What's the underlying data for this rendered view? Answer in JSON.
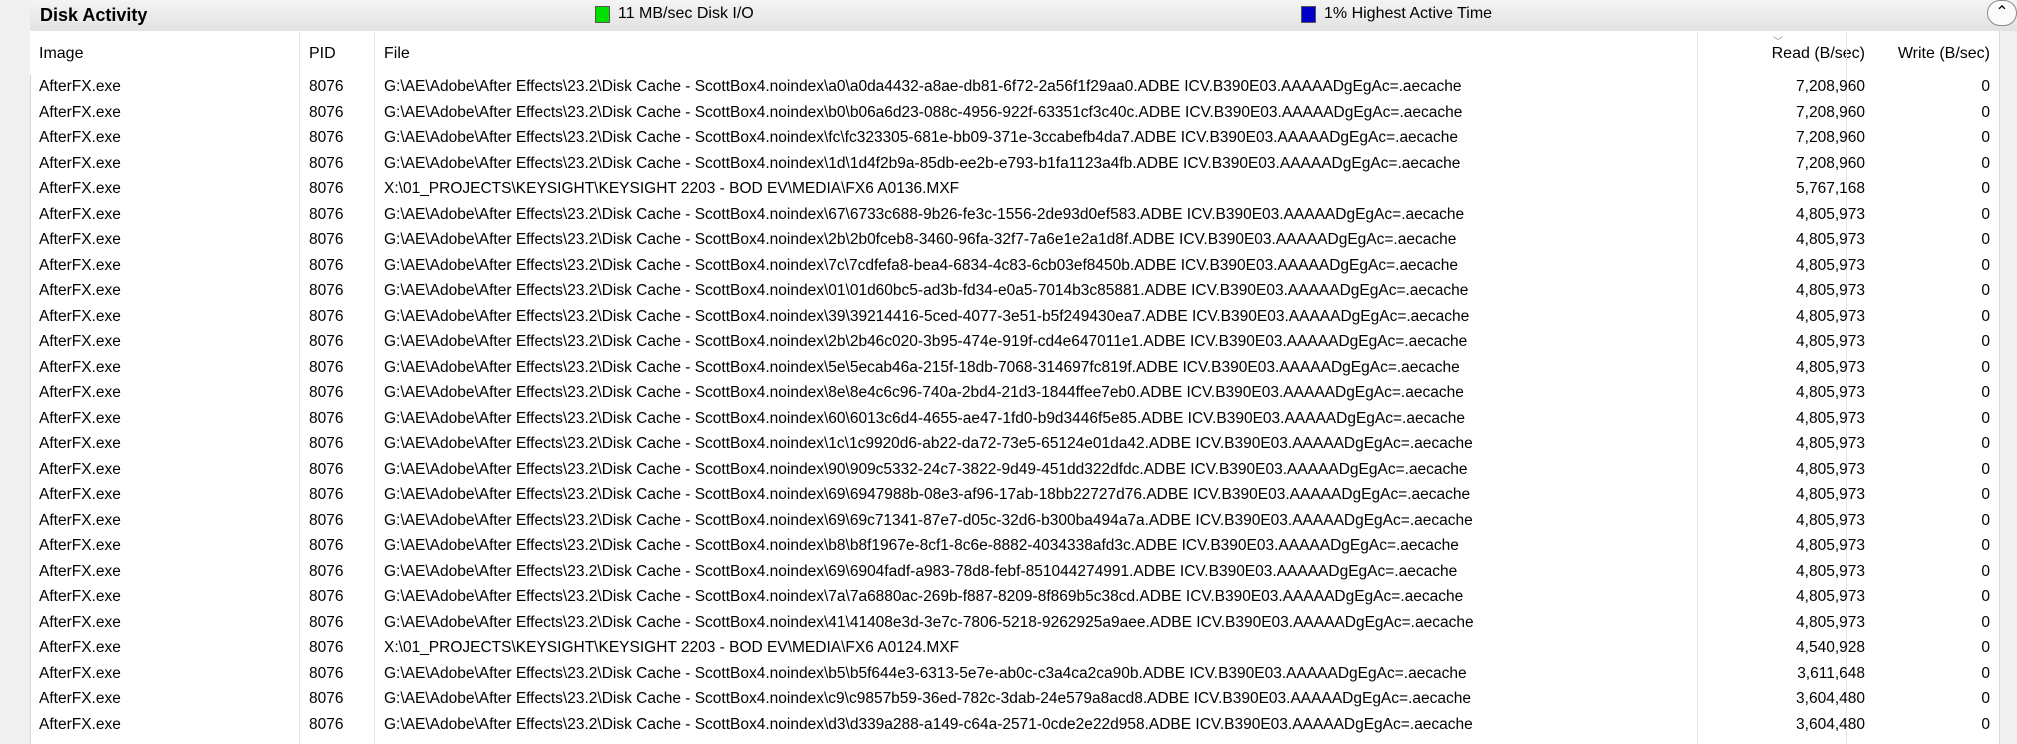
{
  "header": {
    "title": "Disk Activity",
    "io_legend": "11 MB/sec Disk I/O",
    "io_color": "#00e000",
    "active_legend": "1% Highest Active Time",
    "active_color": "#0000c8",
    "collapse_glyph": "⌃"
  },
  "columns": {
    "image": "Image",
    "pid": "PID",
    "file": "File",
    "read": "Read (B/sec)",
    "write": "Write (B/sec)"
  },
  "rows": [
    {
      "image": "AfterFX.exe",
      "pid": "8076",
      "file": "G:\\AE\\Adobe\\After Effects\\23.2\\Disk Cache - ScottBox4.noindex\\a0\\a0da4432-a8ae-db81-6f72-2a56f1f29aa0.ADBE ICV.B390E03.AAAAADgEgAc=.aecache",
      "read": "7,208,960",
      "write": "0"
    },
    {
      "image": "AfterFX.exe",
      "pid": "8076",
      "file": "G:\\AE\\Adobe\\After Effects\\23.2\\Disk Cache - ScottBox4.noindex\\b0\\b06a6d23-088c-4956-922f-63351cf3c40c.ADBE ICV.B390E03.AAAAADgEgAc=.aecache",
      "read": "7,208,960",
      "write": "0"
    },
    {
      "image": "AfterFX.exe",
      "pid": "8076",
      "file": "G:\\AE\\Adobe\\After Effects\\23.2\\Disk Cache - ScottBox4.noindex\\fc\\fc323305-681e-bb09-371e-3ccabefb4da7.ADBE ICV.B390E03.AAAAADgEgAc=.aecache",
      "read": "7,208,960",
      "write": "0"
    },
    {
      "image": "AfterFX.exe",
      "pid": "8076",
      "file": "G:\\AE\\Adobe\\After Effects\\23.2\\Disk Cache - ScottBox4.noindex\\1d\\1d4f2b9a-85db-ee2b-e793-b1fa1123a4fb.ADBE ICV.B390E03.AAAAADgEgAc=.aecache",
      "read": "7,208,960",
      "write": "0"
    },
    {
      "image": "AfterFX.exe",
      "pid": "8076",
      "file": "X:\\01_PROJECTS\\KEYSIGHT\\KEYSIGHT 2203 - BOD EV\\MEDIA\\FX6 A0136.MXF",
      "read": "5,767,168",
      "write": "0"
    },
    {
      "image": "AfterFX.exe",
      "pid": "8076",
      "file": "G:\\AE\\Adobe\\After Effects\\23.2\\Disk Cache - ScottBox4.noindex\\67\\6733c688-9b26-fe3c-1556-2de93d0ef583.ADBE ICV.B390E03.AAAAADgEgAc=.aecache",
      "read": "4,805,973",
      "write": "0"
    },
    {
      "image": "AfterFX.exe",
      "pid": "8076",
      "file": "G:\\AE\\Adobe\\After Effects\\23.2\\Disk Cache - ScottBox4.noindex\\2b\\2b0fceb8-3460-96fa-32f7-7a6e1e2a1d8f.ADBE ICV.B390E03.AAAAADgEgAc=.aecache",
      "read": "4,805,973",
      "write": "0"
    },
    {
      "image": "AfterFX.exe",
      "pid": "8076",
      "file": "G:\\AE\\Adobe\\After Effects\\23.2\\Disk Cache - ScottBox4.noindex\\7c\\7cdfefa8-bea4-6834-4c83-6cb03ef8450b.ADBE ICV.B390E03.AAAAADgEgAc=.aecache",
      "read": "4,805,973",
      "write": "0"
    },
    {
      "image": "AfterFX.exe",
      "pid": "8076",
      "file": "G:\\AE\\Adobe\\After Effects\\23.2\\Disk Cache - ScottBox4.noindex\\01\\01d60bc5-ad3b-fd34-e0a5-7014b3c85881.ADBE ICV.B390E03.AAAAADgEgAc=.aecache",
      "read": "4,805,973",
      "write": "0"
    },
    {
      "image": "AfterFX.exe",
      "pid": "8076",
      "file": "G:\\AE\\Adobe\\After Effects\\23.2\\Disk Cache - ScottBox4.noindex\\39\\39214416-5ced-4077-3e51-b5f249430ea7.ADBE ICV.B390E03.AAAAADgEgAc=.aecache",
      "read": "4,805,973",
      "write": "0"
    },
    {
      "image": "AfterFX.exe",
      "pid": "8076",
      "file": "G:\\AE\\Adobe\\After Effects\\23.2\\Disk Cache - ScottBox4.noindex\\2b\\2b46c020-3b95-474e-919f-cd4e647011e1.ADBE ICV.B390E03.AAAAADgEgAc=.aecache",
      "read": "4,805,973",
      "write": "0"
    },
    {
      "image": "AfterFX.exe",
      "pid": "8076",
      "file": "G:\\AE\\Adobe\\After Effects\\23.2\\Disk Cache - ScottBox4.noindex\\5e\\5ecab46a-215f-18db-7068-314697fc819f.ADBE ICV.B390E03.AAAAADgEgAc=.aecache",
      "read": "4,805,973",
      "write": "0"
    },
    {
      "image": "AfterFX.exe",
      "pid": "8076",
      "file": "G:\\AE\\Adobe\\After Effects\\23.2\\Disk Cache - ScottBox4.noindex\\8e\\8e4c6c96-740a-2bd4-21d3-1844ffee7eb0.ADBE ICV.B390E03.AAAAADgEgAc=.aecache",
      "read": "4,805,973",
      "write": "0"
    },
    {
      "image": "AfterFX.exe",
      "pid": "8076",
      "file": "G:\\AE\\Adobe\\After Effects\\23.2\\Disk Cache - ScottBox4.noindex\\60\\6013c6d4-4655-ae47-1fd0-b9d3446f5e85.ADBE ICV.B390E03.AAAAADgEgAc=.aecache",
      "read": "4,805,973",
      "write": "0"
    },
    {
      "image": "AfterFX.exe",
      "pid": "8076",
      "file": "G:\\AE\\Adobe\\After Effects\\23.2\\Disk Cache - ScottBox4.noindex\\1c\\1c9920d6-ab22-da72-73e5-65124e01da42.ADBE ICV.B390E03.AAAAADgEgAc=.aecache",
      "read": "4,805,973",
      "write": "0"
    },
    {
      "image": "AfterFX.exe",
      "pid": "8076",
      "file": "G:\\AE\\Adobe\\After Effects\\23.2\\Disk Cache - ScottBox4.noindex\\90\\909c5332-24c7-3822-9d49-451dd322dfdc.ADBE ICV.B390E03.AAAAADgEgAc=.aecache",
      "read": "4,805,973",
      "write": "0"
    },
    {
      "image": "AfterFX.exe",
      "pid": "8076",
      "file": "G:\\AE\\Adobe\\After Effects\\23.2\\Disk Cache - ScottBox4.noindex\\69\\6947988b-08e3-af96-17ab-18bb22727d76.ADBE ICV.B390E03.AAAAADgEgAc=.aecache",
      "read": "4,805,973",
      "write": "0"
    },
    {
      "image": "AfterFX.exe",
      "pid": "8076",
      "file": "G:\\AE\\Adobe\\After Effects\\23.2\\Disk Cache - ScottBox4.noindex\\69\\69c71341-87e7-d05c-32d6-b300ba494a7a.ADBE ICV.B390E03.AAAAADgEgAc=.aecache",
      "read": "4,805,973",
      "write": "0"
    },
    {
      "image": "AfterFX.exe",
      "pid": "8076",
      "file": "G:\\AE\\Adobe\\After Effects\\23.2\\Disk Cache - ScottBox4.noindex\\b8\\b8f1967e-8cf1-8c6e-8882-4034338afd3c.ADBE ICV.B390E03.AAAAADgEgAc=.aecache",
      "read": "4,805,973",
      "write": "0"
    },
    {
      "image": "AfterFX.exe",
      "pid": "8076",
      "file": "G:\\AE\\Adobe\\After Effects\\23.2\\Disk Cache - ScottBox4.noindex\\69\\6904fadf-a983-78d8-febf-851044274991.ADBE ICV.B390E03.AAAAADgEgAc=.aecache",
      "read": "4,805,973",
      "write": "0"
    },
    {
      "image": "AfterFX.exe",
      "pid": "8076",
      "file": "G:\\AE\\Adobe\\After Effects\\23.2\\Disk Cache - ScottBox4.noindex\\7a\\7a6880ac-269b-f887-8209-8f869b5c38cd.ADBE ICV.B390E03.AAAAADgEgAc=.aecache",
      "read": "4,805,973",
      "write": "0"
    },
    {
      "image": "AfterFX.exe",
      "pid": "8076",
      "file": "G:\\AE\\Adobe\\After Effects\\23.2\\Disk Cache - ScottBox4.noindex\\41\\41408e3d-3e7c-7806-5218-9262925a9aee.ADBE ICV.B390E03.AAAAADgEgAc=.aecache",
      "read": "4,805,973",
      "write": "0"
    },
    {
      "image": "AfterFX.exe",
      "pid": "8076",
      "file": "X:\\01_PROJECTS\\KEYSIGHT\\KEYSIGHT 2203 - BOD EV\\MEDIA\\FX6 A0124.MXF",
      "read": "4,540,928",
      "write": "0"
    },
    {
      "image": "AfterFX.exe",
      "pid": "8076",
      "file": "G:\\AE\\Adobe\\After Effects\\23.2\\Disk Cache - ScottBox4.noindex\\b5\\b5f644e3-6313-5e7e-ab0c-c3a4ca2ca90b.ADBE ICV.B390E03.AAAAADgEgAc=.aecache",
      "read": "3,611,648",
      "write": "0"
    },
    {
      "image": "AfterFX.exe",
      "pid": "8076",
      "file": "G:\\AE\\Adobe\\After Effects\\23.2\\Disk Cache - ScottBox4.noindex\\c9\\c9857b59-36ed-782c-3dab-24e579a8acd8.ADBE ICV.B390E03.AAAAADgEgAc=.aecache",
      "read": "3,604,480",
      "write": "0"
    },
    {
      "image": "AfterFX.exe",
      "pid": "8076",
      "file": "G:\\AE\\Adobe\\After Effects\\23.2\\Disk Cache - ScottBox4.noindex\\d3\\d339a288-a149-c64a-2571-0cde2e22d958.ADBE ICV.B390E03.AAAAADgEgAc=.aecache",
      "read": "3,604,480",
      "write": "0"
    }
  ]
}
